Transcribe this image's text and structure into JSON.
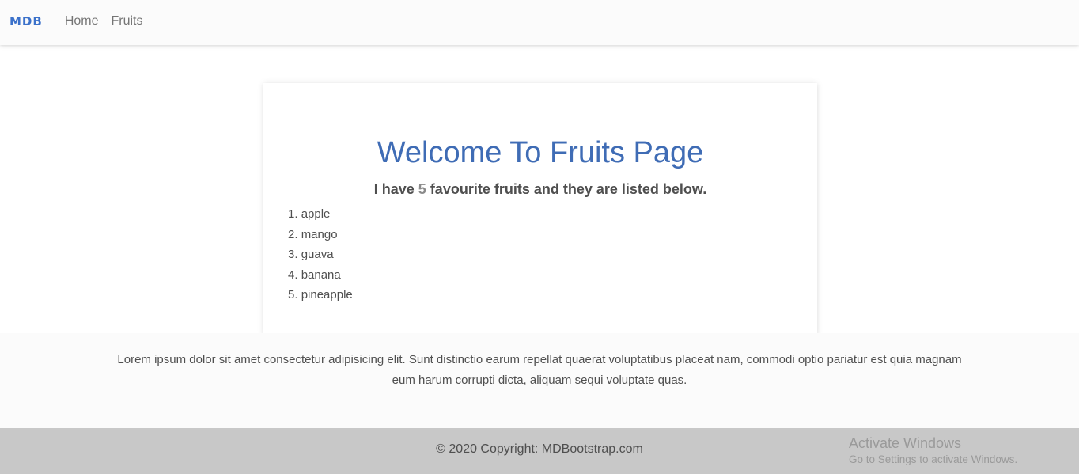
{
  "navbar": {
    "brand": "MDB",
    "links": [
      "Home",
      "Fruits"
    ]
  },
  "card": {
    "title": "Welcome To Fruits Page",
    "subtitle_prefix": "I have ",
    "fruit_count": "5",
    "subtitle_suffix": " favourite fruits and they are listed below.",
    "fruits": [
      "apple",
      "mango",
      "guava",
      "banana",
      "pineapple"
    ]
  },
  "lorem": {
    "text": "Lorem ipsum dolor sit amet consectetur adipisicing elit. Sunt distinctio earum repellat quaerat voluptatibus placeat nam, commodi optio pariatur est quia magnam eum harum corrupti dicta, aliquam sequi voluptate quas."
  },
  "footer": {
    "copyright": "© 2020 Copyright: MDBootstrap.com"
  },
  "watermark": {
    "title": "Activate Windows",
    "subtitle": "Go to Settings to activate Windows."
  },
  "colors": {
    "brand": "#3b71ca",
    "title": "#3f6cb5",
    "footer_bg": "#c8c8c8"
  }
}
